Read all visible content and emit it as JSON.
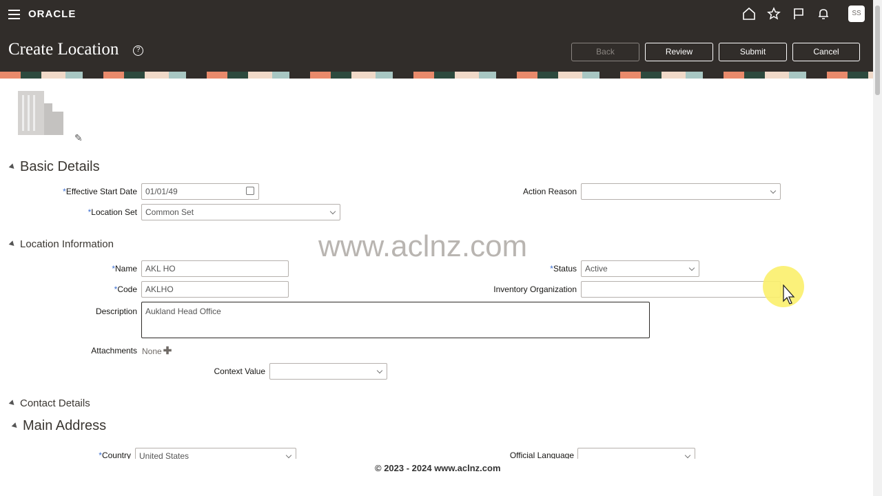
{
  "header": {
    "logo": "ORACLE",
    "avatar": "SS",
    "icons": [
      "home-icon",
      "star-icon",
      "flag-icon",
      "bell-icon"
    ]
  },
  "page": {
    "title": "Create Location",
    "buttons": {
      "back": "Back",
      "review": "Review",
      "submit": "Submit",
      "cancel": "Cancel"
    }
  },
  "sections": {
    "basic": "Basic Details",
    "location": "Location Information",
    "contact": "Contact Details",
    "address": "Main Address"
  },
  "basic": {
    "effective_start_date_label": "Effective Start Date",
    "effective_start_date_value": "01/01/49",
    "location_set_label": "Location Set",
    "location_set_value": "Common Set",
    "action_reason_label": "Action Reason",
    "action_reason_value": ""
  },
  "location": {
    "name_label": "Name",
    "name_value": "AKL HO",
    "code_label": "Code",
    "code_value": "AKLHO",
    "status_label": "Status",
    "status_value": "Active",
    "inventory_org_label": "Inventory Organization",
    "inventory_org_value": "",
    "description_label": "Description",
    "description_value": "Aukland Head Office",
    "attachments_label": "Attachments",
    "attachments_value": "None",
    "context_value_label": "Context Value",
    "context_value": ""
  },
  "address": {
    "country_label": "Country",
    "country_value": "United States",
    "official_language_label": "Official Language",
    "official_language_value": ""
  },
  "watermark": "www.aclnz.com",
  "footer": "© 2023 - 2024 www.aclnz.com"
}
